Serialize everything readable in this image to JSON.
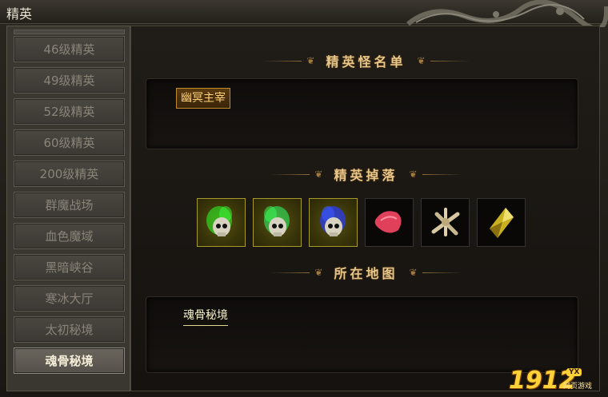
{
  "window": {
    "title": "精英"
  },
  "sidebar": {
    "items": [
      {
        "label": "46级精英",
        "active": false
      },
      {
        "label": "49级精英",
        "active": false
      },
      {
        "label": "52级精英",
        "active": false
      },
      {
        "label": "60级精英",
        "active": false
      },
      {
        "label": "200级精英",
        "active": false
      },
      {
        "label": "群魔战场",
        "active": false
      },
      {
        "label": "血色魔域",
        "active": false
      },
      {
        "label": "黑暗峡谷",
        "active": false
      },
      {
        "label": "寒冰大厅",
        "active": false
      },
      {
        "label": "太初秘境",
        "active": false
      },
      {
        "label": "魂骨秘境",
        "active": true
      }
    ]
  },
  "sections": {
    "monster_list": {
      "title": "精英怪名单",
      "monsters": [
        "幽冥主宰"
      ]
    },
    "drops": {
      "title": "精英掉落",
      "items": [
        {
          "icon": "green-skull-icon"
        },
        {
          "icon": "green-skull-icon"
        },
        {
          "icon": "blue-skull-icon"
        },
        {
          "icon": "red-petal-icon"
        },
        {
          "icon": "bone-pile-icon"
        },
        {
          "icon": "yellow-crystal-icon"
        }
      ]
    },
    "location": {
      "title": "所在地图",
      "maps": [
        "魂骨秘境"
      ]
    }
  },
  "logo": {
    "number": "1912",
    "badge": "YX",
    "sub": "网页游戏"
  },
  "colors": {
    "accent_gold": "#e8c68a",
    "tag_border": "#c08a2a",
    "active_tab": "#6a665e"
  }
}
